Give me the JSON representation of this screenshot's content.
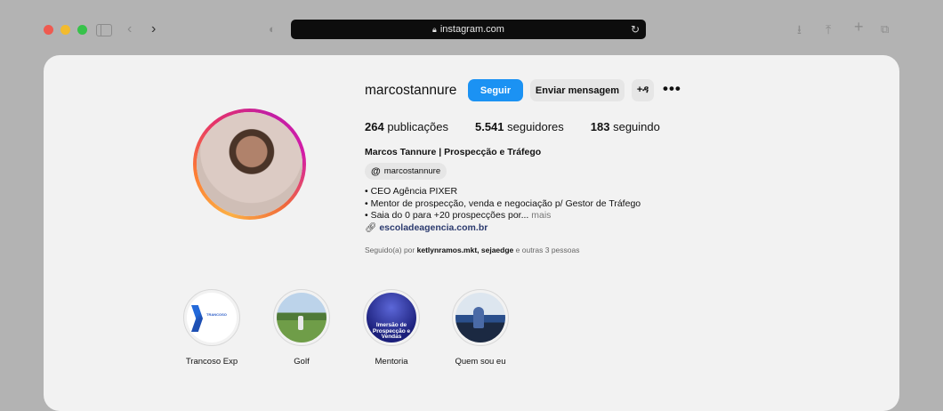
{
  "browser": {
    "url": "instagram.com",
    "icons": [
      "sidebar-icon",
      "back-icon",
      "forward-icon",
      "shield-icon",
      "lock-icon",
      "reload-icon",
      "download-icon",
      "share-icon",
      "new-tab-icon",
      "tabs-overview-icon"
    ]
  },
  "profile": {
    "username": "marcostannure",
    "follow_label": "Seguir",
    "message_label": "Enviar mensagem",
    "add_user_icon": "+ዳ",
    "more_icon": "•••",
    "stats": {
      "posts_count": "264",
      "posts_label": "publicações",
      "followers_count": "5.541",
      "followers_label": "seguidores",
      "following_count": "183",
      "following_label": "seguindo"
    },
    "full_name": "Marcos Tannure | Prospecção e Tráfego",
    "threads_handle": "marcostannure",
    "bio": [
      "• CEO Agência PIXER",
      "• Mentor de prospecção, venda e negociação p/ Gestor de Tráfego",
      "• Saia do 0 para +20 prospecções por..."
    ],
    "bio_more": "mais",
    "link": "escoladeagencia.com.br",
    "followed_by_prefix": "Seguido(a) por",
    "followed_by_users": "ketlynramos.mkt, sejaedge",
    "followed_by_suffix": "e outras 3 pessoas"
  },
  "highlights": [
    {
      "label": "Trancoso Exp",
      "pic_text": "TRANCOSO"
    },
    {
      "label": "Golf"
    },
    {
      "label": "Mentoria",
      "pic_text": "Imersão de Prospecção e Vendas"
    },
    {
      "label": "Quem sou eu"
    }
  ],
  "colors": {
    "follow_button": "#1b92f3",
    "page_background": "#f2f2f2",
    "browser_chrome": "#b3b3b3"
  }
}
